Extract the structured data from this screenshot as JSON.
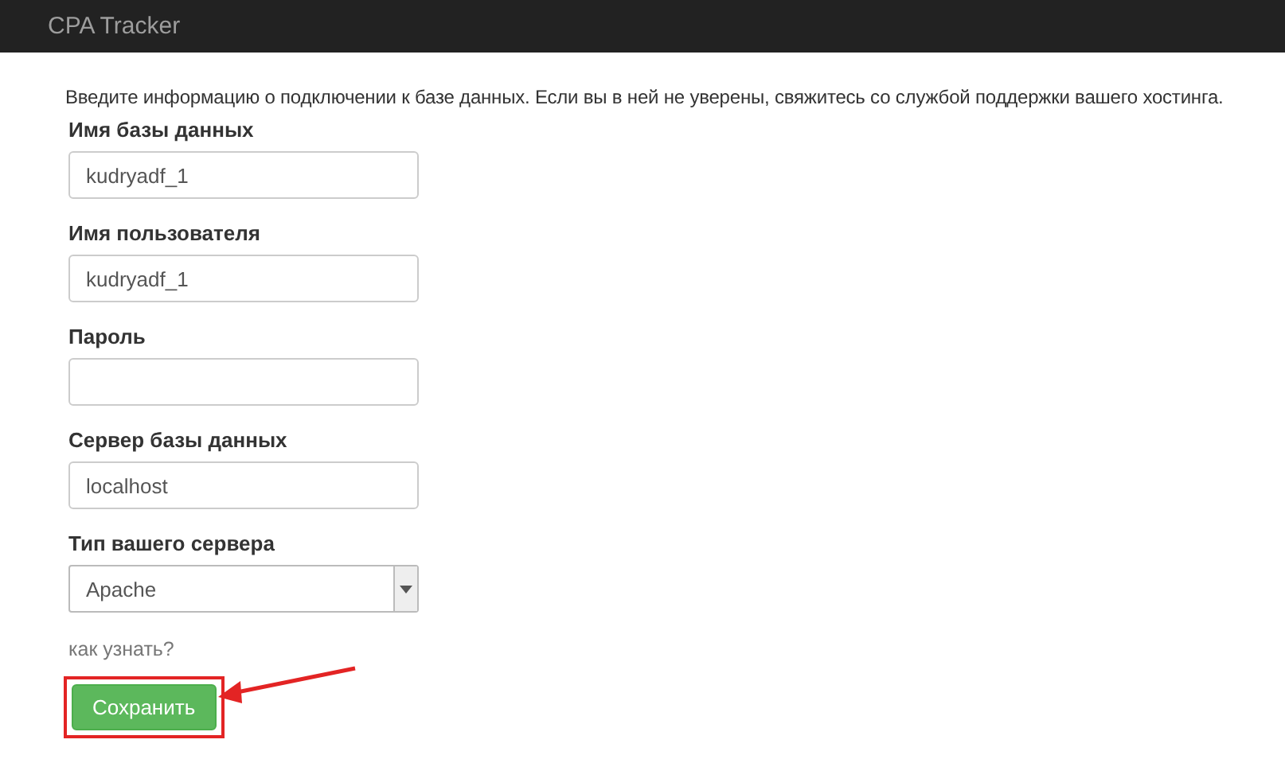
{
  "header": {
    "title": "CPA Tracker"
  },
  "intro": "Введите информацию о подключении к базе данных. Если вы в ней не уверены, свяжитесь со службой поддержки вашего хостинга.",
  "fields": [
    {
      "kind": "text",
      "label": "Имя базы данных",
      "value": "kudryadf_1"
    },
    {
      "kind": "text",
      "label": "Имя пользователя",
      "value": "kudryadf_1"
    },
    {
      "kind": "password",
      "label": "Пароль"
    },
    {
      "kind": "text",
      "label": "Сервер базы данных",
      "value": "localhost"
    },
    {
      "kind": "select",
      "label": "Тип вашего сервера",
      "value": "Apache"
    }
  ],
  "help_link": "как узнать?",
  "save_button": {
    "label": "Сохранить",
    "highlighted": true
  }
}
